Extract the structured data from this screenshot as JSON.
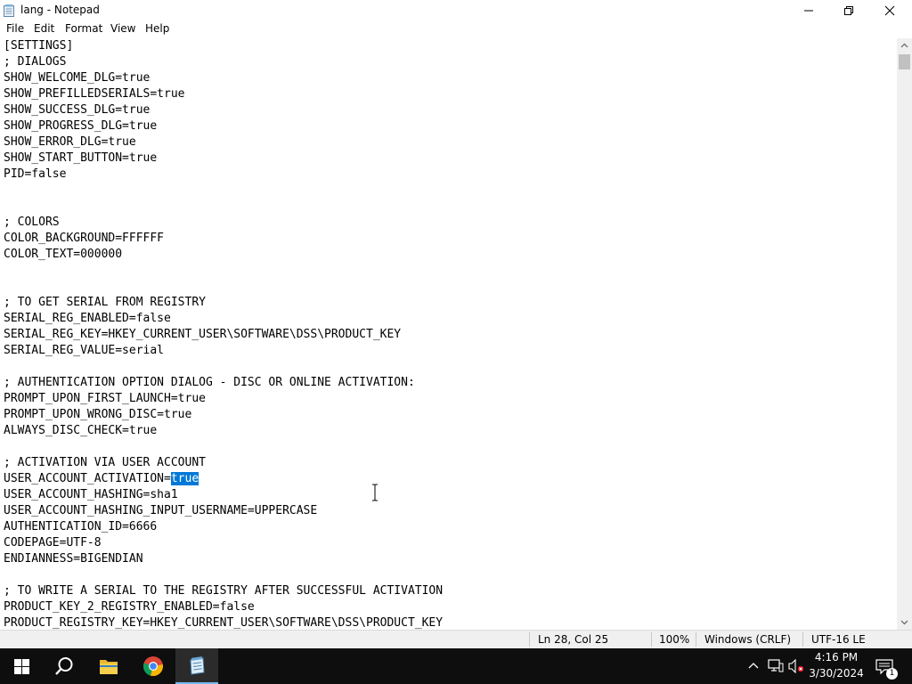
{
  "window": {
    "title": "lang - Notepad",
    "icon": "notepad-icon",
    "controls": [
      "minimize-icon",
      "maximize-icon",
      "close-icon"
    ]
  },
  "menu": [
    "File",
    "Edit",
    "Format",
    "View",
    "Help"
  ],
  "editor": {
    "lines": [
      "[SETTINGS]",
      "; DIALOGS",
      "SHOW_WELCOME_DLG=true",
      "SHOW_PREFILLEDSERIALS=true",
      "SHOW_SUCCESS_DLG=true",
      "SHOW_PROGRESS_DLG=true",
      "SHOW_ERROR_DLG=true",
      "SHOW_START_BUTTON=true",
      "PID=false",
      "",
      "",
      "; COLORS",
      "COLOR_BACKGROUND=FFFFFF",
      "COLOR_TEXT=000000",
      "",
      "",
      "; TO GET SERIAL FROM REGISTRY",
      "SERIAL_REG_ENABLED=false",
      "SERIAL_REG_KEY=HKEY_CURRENT_USER\\SOFTWARE\\DSS\\PRODUCT_KEY",
      "SERIAL_REG_VALUE=serial",
      "",
      "; AUTHENTICATION OPTION DIALOG - DISC OR ONLINE ACTIVATION:",
      "PROMPT_UPON_FIRST_LAUNCH=true",
      "PROMPT_UPON_WRONG_DISC=true",
      "ALWAYS_DISC_CHECK=true",
      "",
      "; ACTIVATION VIA USER ACCOUNT",
      "USER_ACCOUNT_ACTIVATION=true",
      "USER_ACCOUNT_HASHING=sha1",
      "USER_ACCOUNT_HASHING_INPUT_USERNAME=UPPERCASE",
      "AUTHENTICATION_ID=6666",
      "CODEPAGE=UTF-8",
      "ENDIANNESS=BIGENDIAN",
      "",
      "; TO WRITE A SERIAL TO THE REGISTRY AFTER SUCCESSFUL ACTIVATION",
      "PRODUCT_KEY_2_REGISTRY_ENABLED=false",
      "PRODUCT_REGISTRY_KEY=HKEY_CURRENT_USER\\SOFTWARE\\DSS\\PRODUCT_KEY"
    ],
    "selection": {
      "line": 27,
      "selected_text": "true"
    },
    "selection_color": "#0078d7"
  },
  "status": {
    "position": "Ln 28, Col 25",
    "zoom": "100%",
    "line_endings": "Windows (CRLF)",
    "encoding": "UTF-16 LE"
  },
  "taskbar": {
    "apps": [
      "start-icon",
      "search-icon",
      "file-explorer-icon",
      "chrome-icon",
      "notepad-icon"
    ],
    "tray": [
      "chevron-up-icon",
      "network-icon",
      "volume-muted-icon"
    ],
    "time": "4:16 PM",
    "date": "3/30/2024",
    "notification_count": "1"
  }
}
